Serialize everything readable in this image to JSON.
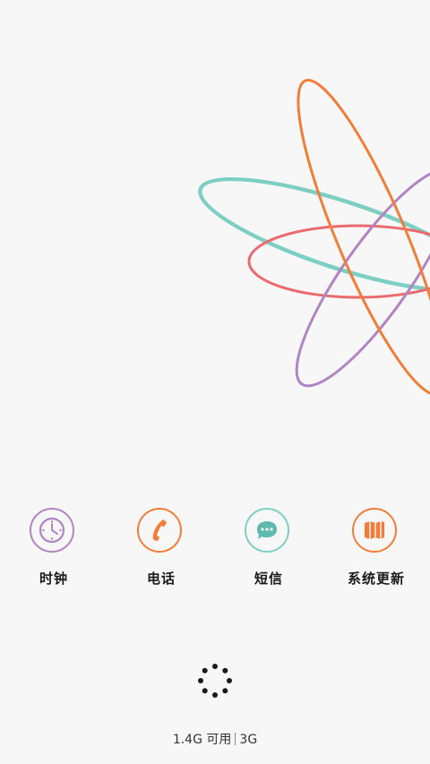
{
  "colors": {
    "background": "#f7f7f7",
    "orange": "#f07e3a",
    "teal": "#7ccfc2",
    "coral": "#ea6a6e",
    "purple": "#b184c2",
    "spinner": "#1a1a1a"
  },
  "apps": [
    {
      "label": "时钟",
      "icon": "clock-icon",
      "color": "#b184c2"
    },
    {
      "label": "电话",
      "icon": "phone-icon",
      "color": "#f07e3a"
    },
    {
      "label": "短信",
      "icon": "message-icon",
      "color": "#7ccfc2"
    },
    {
      "label": "系统更新",
      "icon": "map-icon",
      "color": "#f07e3a"
    }
  ],
  "status": {
    "storage_text": "1.4G 可用",
    "network_text": "3G"
  }
}
